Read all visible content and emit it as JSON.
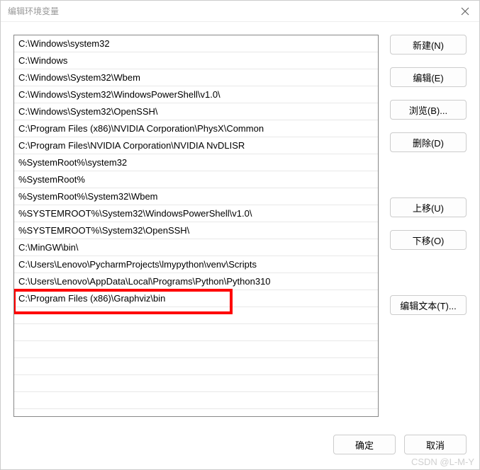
{
  "window": {
    "title": "编辑环境变量"
  },
  "list": {
    "items": [
      "C:\\Windows\\system32",
      "C:\\Windows",
      "C:\\Windows\\System32\\Wbem",
      "C:\\Windows\\System32\\WindowsPowerShell\\v1.0\\",
      "C:\\Windows\\System32\\OpenSSH\\",
      "C:\\Program Files (x86)\\NVIDIA Corporation\\PhysX\\Common",
      "C:\\Program Files\\NVIDIA Corporation\\NVIDIA NvDLISR",
      "%SystemRoot%\\system32",
      "%SystemRoot%",
      "%SystemRoot%\\System32\\Wbem",
      "%SYSTEMROOT%\\System32\\WindowsPowerShell\\v1.0\\",
      "%SYSTEMROOT%\\System32\\OpenSSH\\",
      "C:\\MinGW\\bin\\",
      "C:\\Users\\Lenovo\\PycharmProjects\\lmypython\\venv\\Scripts",
      "C:\\Users\\Lenovo\\AppData\\Local\\Programs\\Python\\Python310",
      "C:\\Program Files (x86)\\Graphviz\\bin"
    ],
    "highlighted_index": 15
  },
  "buttons": {
    "new": "新建(N)",
    "edit": "编辑(E)",
    "browse": "浏览(B)...",
    "delete": "删除(D)",
    "moveup": "上移(U)",
    "movedown": "下移(O)",
    "edittext": "编辑文本(T)..."
  },
  "footer": {
    "ok": "确定",
    "cancel": "取消"
  },
  "watermark": "CSDN @L-M-Y"
}
